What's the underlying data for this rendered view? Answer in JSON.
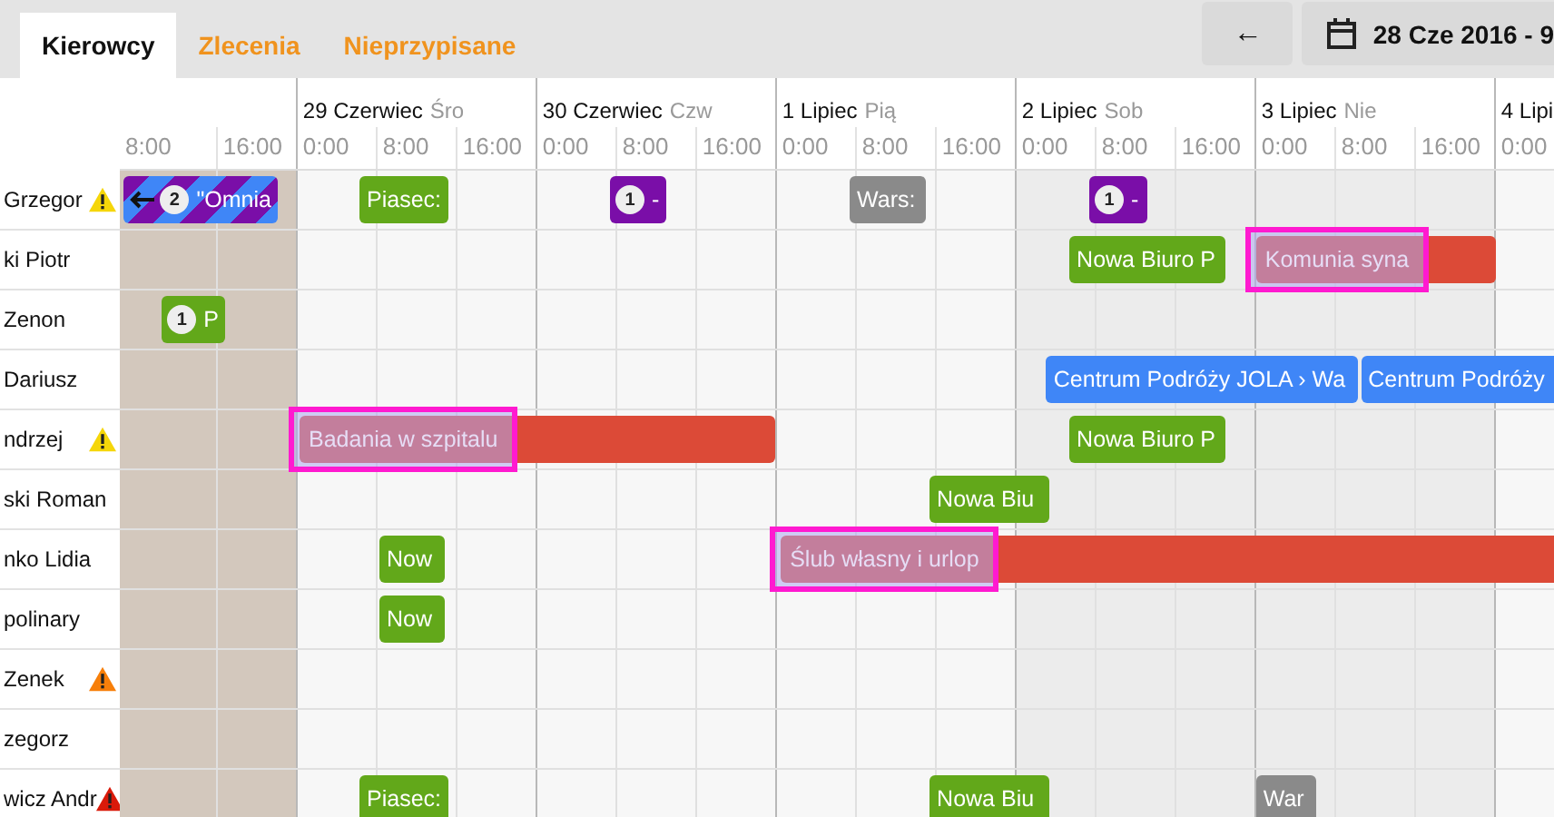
{
  "tabs": [
    {
      "label": "Kierowcy",
      "selected": true
    },
    {
      "label": "Zlecenia",
      "selected": false
    },
    {
      "label": "Nieprzypisane",
      "selected": false
    }
  ],
  "toolbar": {
    "back_button": "←",
    "date_range": "28 Cze 2016 - 9"
  },
  "days": [
    {
      "kind": "past",
      "slots": [
        "8:00",
        "16:00"
      ]
    },
    {
      "label": "29 Czerwiec",
      "weekday": "Śro",
      "kind": "workday",
      "slots": [
        "0:00",
        "8:00",
        "16:00"
      ]
    },
    {
      "label": "30 Czerwiec",
      "weekday": "Czw",
      "kind": "workday",
      "slots": [
        "0:00",
        "8:00",
        "16:00"
      ]
    },
    {
      "label": "1 Lipiec",
      "weekday": "Pią",
      "kind": "workday",
      "slots": [
        "0:00",
        "8:00",
        "16:00"
      ]
    },
    {
      "label": "2 Lipiec",
      "weekday": "Sob",
      "kind": "weekend",
      "slots": [
        "0:00",
        "8:00",
        "16:00"
      ]
    },
    {
      "label": "3 Lipiec",
      "weekday": "Nie",
      "kind": "weekend",
      "slots": [
        "0:00",
        "8:00",
        "16:00"
      ]
    },
    {
      "label": "4 Lipi",
      "kind": "workday",
      "slots": [
        "0:00"
      ]
    }
  ],
  "drivers": [
    {
      "name": "Grzegor",
      "warning": {
        "color": "#f5d60a"
      },
      "events": [
        {
          "text": "\"Omnia",
          "badge": "2",
          "kind": "striped",
          "color": "#3f86f7",
          "continues_left": true,
          "selected": false
        },
        {
          "text": "Piasec:",
          "kind": "plain",
          "color": "#62a81a",
          "selected": false
        },
        {
          "text": "-",
          "badge": "1",
          "kind": "plain",
          "color": "#7a0ea8",
          "selected": false
        },
        {
          "text": "Wars:",
          "kind": "plain",
          "color": "#8a8a8a",
          "selected": false
        },
        {
          "text": "-",
          "badge": "1",
          "kind": "plain",
          "color": "#7a0ea8",
          "selected": false
        }
      ]
    },
    {
      "name": "ki Piotr",
      "events": [
        {
          "text": "Nowa Biuro P",
          "kind": "plain",
          "color": "#62a81a",
          "selected": false
        },
        {
          "text": "Komunia syna",
          "kind": "plain",
          "color": "#dc4a37",
          "selected": true
        }
      ]
    },
    {
      "name": "Zenon",
      "events": [
        {
          "text": "P",
          "badge": "1",
          "kind": "plain",
          "color": "#62a81a",
          "selected": false
        }
      ]
    },
    {
      "name": "Dariusz",
      "events": [
        {
          "text": "Centrum Podróży JOLA › Wa",
          "kind": "plain",
          "color": "#3f86f7",
          "selected": false
        },
        {
          "text": "Centrum Podróży",
          "kind": "plain",
          "color": "#3f86f7",
          "selected": false
        }
      ]
    },
    {
      "name": "ndrzej",
      "warning": {
        "color": "#f5d60a"
      },
      "events": [
        {
          "text": "Badania w szpitalu",
          "kind": "plain",
          "color": "#dc4a37",
          "selected": true
        },
        {
          "text": "Nowa Biuro P",
          "kind": "plain",
          "color": "#62a81a",
          "selected": false
        }
      ]
    },
    {
      "name": "ski Roman",
      "events": [
        {
          "text": "Nowa Biu",
          "kind": "plain",
          "color": "#62a81a",
          "selected": false
        }
      ]
    },
    {
      "name": "nko Lidia",
      "events": [
        {
          "text": "Now",
          "kind": "plain",
          "color": "#62a81a",
          "selected": false
        },
        {
          "text": "Ślub własny i urlop",
          "kind": "plain",
          "color": "#dc4a37",
          "selected": true
        }
      ]
    },
    {
      "name": "polinary",
      "events": [
        {
          "text": "Now",
          "kind": "plain",
          "color": "#62a81a",
          "selected": false
        }
      ]
    },
    {
      "name": "Zenek",
      "warning": {
        "color": "#f77f0a"
      }
    },
    {
      "name": "zegorz"
    },
    {
      "name": "wicz Andr",
      "warning": {
        "color": "#d91a0a"
      },
      "events": [
        {
          "text": "Piasec:",
          "kind": "plain",
          "color": "#62a81a",
          "selected": false
        },
        {
          "text": "Nowa Biu",
          "kind": "plain",
          "color": "#62a81a",
          "selected": false
        },
        {
          "text": "War",
          "kind": "plain",
          "color": "#8a8a8a",
          "selected": false
        }
      ]
    }
  ]
}
